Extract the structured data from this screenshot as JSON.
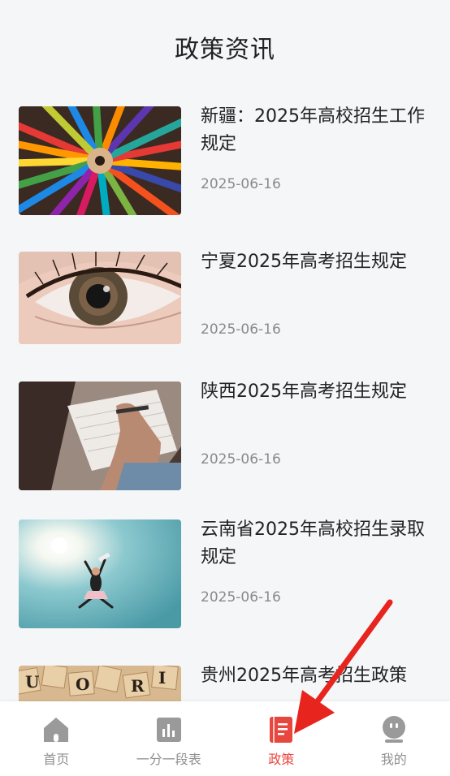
{
  "header": {
    "title": "政策资讯"
  },
  "news": [
    {
      "title": "新疆：2025年高校招生工作规定",
      "date": "2025-06-16",
      "image": "colored-pencils"
    },
    {
      "title": "宁夏2025年高考招生规定",
      "date": "2025-06-16",
      "image": "eye-closeup"
    },
    {
      "title": "陕西2025年高考招生规定",
      "date": "2025-06-16",
      "image": "hand-writing"
    },
    {
      "title": "云南省2025年高校招生录取规定",
      "date": "2025-06-16",
      "image": "jumping-sky"
    },
    {
      "title": "贵州2025年高考招生政策",
      "date": "",
      "image": "letter-tiles"
    }
  ],
  "tabbar": {
    "items": [
      {
        "label": "首页",
        "icon": "home-icon",
        "active": false
      },
      {
        "label": "一分一段表",
        "icon": "chart-icon",
        "active": false
      },
      {
        "label": "政策",
        "icon": "book-icon",
        "active": true
      },
      {
        "label": "我的",
        "icon": "profile-icon",
        "active": false
      }
    ]
  },
  "colors": {
    "accent": "#e8473f",
    "annotation_arrow": "#e8241e",
    "inactive": "#8f8f8f"
  }
}
